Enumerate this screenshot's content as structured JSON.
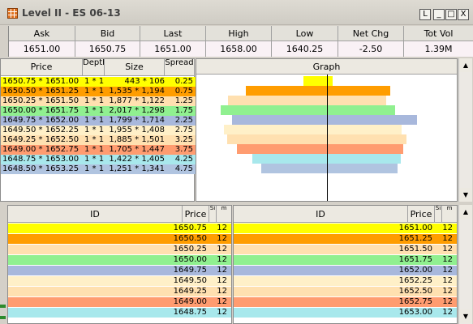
{
  "window": {
    "title": "Level II - ES 06-13",
    "buttons": [
      "L",
      "_",
      "□",
      "X"
    ]
  },
  "stats": {
    "headers": [
      "Ask",
      "Bid",
      "Last",
      "High",
      "Low",
      "Net Chg",
      "Tot Vol"
    ],
    "values": [
      "1651.00",
      "1650.75",
      "1651.00",
      "1658.00",
      "1640.25",
      "-2.50",
      "1.39M"
    ]
  },
  "book": {
    "headers": {
      "price": "Price",
      "depth": "Depth",
      "size": "Size",
      "spread": "Spread"
    },
    "rows": [
      {
        "price": "1650.75 * 1651.00",
        "depth": "1 * 1",
        "size": "443 * 106",
        "spread": "0.25",
        "color": "#ffff00"
      },
      {
        "price": "1650.50 * 1651.25",
        "depth": "1 * 1",
        "size": "1,535 * 1,194",
        "spread": "0.75",
        "color": "#ff9d00"
      },
      {
        "price": "1650.25 * 1651.50",
        "depth": "1 * 1",
        "size": "1,877 * 1,122",
        "spread": "1.25",
        "color": "#ffe0b0"
      },
      {
        "price": "1650.00 * 1651.75",
        "depth": "1 * 1",
        "size": "2,017 * 1,298",
        "spread": "1.75",
        "color": "#90f090"
      },
      {
        "price": "1649.75 * 1652.00",
        "depth": "1 * 1",
        "size": "1,799 * 1,714",
        "spread": "2.25",
        "color": "#a8b8dc"
      },
      {
        "price": "1649.50 * 1652.25",
        "depth": "1 * 1",
        "size": "1,955 * 1,408",
        "spread": "2.75",
        "color": "#fff0c8"
      },
      {
        "price": "1649.25 * 1652.50",
        "depth": "1 * 1",
        "size": "1,885 * 1,501",
        "spread": "3.25",
        "color": "#ffe0b0"
      },
      {
        "price": "1649.00 * 1652.75",
        "depth": "1 * 1",
        "size": "1,705 * 1,447",
        "spread": "3.75",
        "color": "#ff9c70"
      },
      {
        "price": "1648.75 * 1653.00",
        "depth": "1 * 1",
        "size": "1,422 * 1,405",
        "spread": "4.25",
        "color": "#a8e8ec"
      },
      {
        "price": "1648.50 * 1653.25",
        "depth": "1 * 1",
        "size": "1,251 * 1,341",
        "spread": "4.75",
        "color": "#b0c4e0"
      }
    ]
  },
  "graph": {
    "title": "Graph"
  },
  "id_tables": {
    "left": {
      "headers": {
        "id": "ID",
        "price": "Price",
        "s": "Si",
        "m": "m"
      },
      "rows": [
        {
          "price": "1650.75",
          "s": "12",
          "color": "#ffff00"
        },
        {
          "price": "1650.50",
          "s": "12",
          "color": "#ff9d00"
        },
        {
          "price": "1650.25",
          "s": "12",
          "color": "#ffe0b0"
        },
        {
          "price": "1650.00",
          "s": "12",
          "color": "#90f090"
        },
        {
          "price": "1649.75",
          "s": "12",
          "color": "#a8b8dc"
        },
        {
          "price": "1649.50",
          "s": "12",
          "color": "#fff0c8"
        },
        {
          "price": "1649.25",
          "s": "12",
          "color": "#ffe0b0"
        },
        {
          "price": "1649.00",
          "s": "12",
          "color": "#ff9c70"
        },
        {
          "price": "1648.75",
          "s": "12",
          "color": "#a8e8ec"
        }
      ]
    },
    "right": {
      "headers": {
        "id": "ID",
        "price": "Price",
        "s": "Si",
        "m": "m"
      },
      "rows": [
        {
          "price": "1651.00",
          "s": "12",
          "color": "#ffff00"
        },
        {
          "price": "1651.25",
          "s": "12",
          "color": "#ff9d00"
        },
        {
          "price": "1651.50",
          "s": "12",
          "color": "#ffe0b0"
        },
        {
          "price": "1651.75",
          "s": "12",
          "color": "#90f090"
        },
        {
          "price": "1652.00",
          "s": "12",
          "color": "#a8b8dc"
        },
        {
          "price": "1652.25",
          "s": "12",
          "color": "#fff0c8"
        },
        {
          "price": "1652.50",
          "s": "12",
          "color": "#ffe0b0"
        },
        {
          "price": "1652.75",
          "s": "12",
          "color": "#ff9c70"
        },
        {
          "price": "1653.00",
          "s": "12",
          "color": "#a8e8ec"
        }
      ]
    }
  }
}
